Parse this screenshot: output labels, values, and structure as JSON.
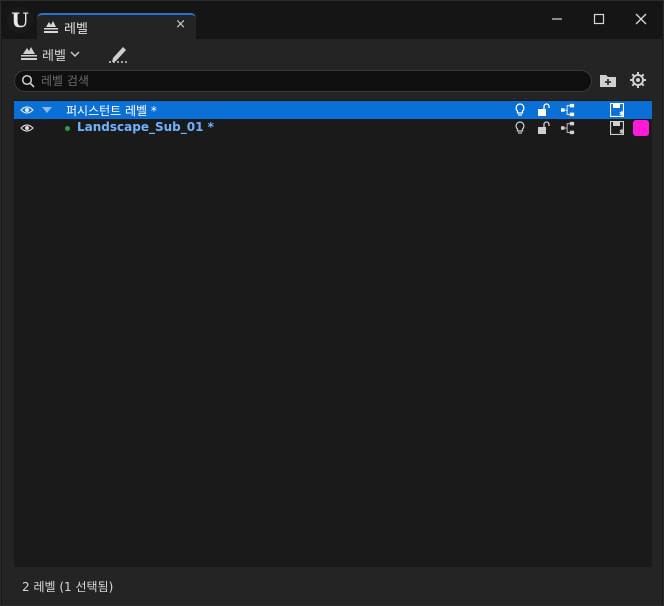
{
  "app": {
    "logo_glyph": "U",
    "logo_icon": "unreal-engine-logo"
  },
  "tab": {
    "title": "레벨",
    "icon": "levels-icon",
    "close_glyph": "×"
  },
  "window_controls": {
    "minimize": "—",
    "maximize": "☐",
    "close": "✕"
  },
  "toolbar": {
    "levels_menu_label": "레벨",
    "levels_menu_icon": "levels-icon",
    "edit_icon": "pencil-edit-icon"
  },
  "search": {
    "placeholder": "레벨 검색",
    "value": "",
    "icon": "search-icon"
  },
  "levels": [
    {
      "name": "퍼시스턴트 레벨 *",
      "selected": true,
      "expanded": true,
      "color": null,
      "name_color": "#ffffff"
    },
    {
      "name": "Landscape_Sub_01 *",
      "selected": false,
      "expanded": false,
      "color": "#ff1ad8",
      "name_color": "#6fb3ff"
    }
  ],
  "columns": [
    "lighting-scenario-icon",
    "lock-icon",
    "hierarchy-icon",
    "save-icon"
  ],
  "status": {
    "text": "2 레벨 (1 선택됨)"
  },
  "colors": {
    "accent": "#0b70d6",
    "selected_row": "#0b70d6",
    "tab_accent": "#2c6fd1",
    "sub_level_name": "#6fb3ff",
    "sub_level_color": "#ff1ad8"
  }
}
